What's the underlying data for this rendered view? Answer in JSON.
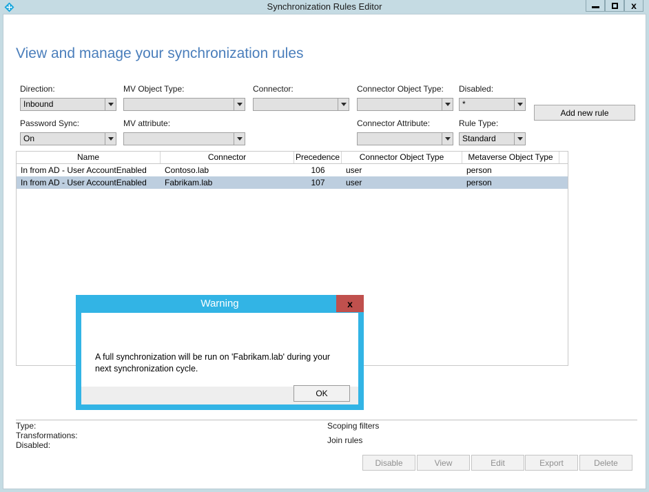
{
  "window": {
    "title": "Synchronization Rules Editor",
    "icon": "sync-diamond-icon",
    "minimize_label": "Minimize",
    "maximize_label": "Maximize",
    "close_label": "x"
  },
  "page": {
    "heading": "View and manage your synchronization rules",
    "heading_color": "#4a7ebb"
  },
  "filters": {
    "direction": {
      "label": "Direction:",
      "value": "Inbound"
    },
    "mv_object_type": {
      "label": "MV Object Type:",
      "value": ""
    },
    "connector": {
      "label": "Connector:",
      "value": ""
    },
    "connector_object_type": {
      "label": "Connector Object Type:",
      "value": ""
    },
    "disabled": {
      "label": "Disabled:",
      "value": "*"
    },
    "password_sync": {
      "label": "Password Sync:",
      "value": "On"
    },
    "mv_attribute": {
      "label": "MV attribute:",
      "value": ""
    },
    "connector_attribute": {
      "label": "Connector Attribute:",
      "value": ""
    },
    "rule_type": {
      "label": "Rule Type:",
      "value": "Standard"
    }
  },
  "toolbar": {
    "add_new_rule": "Add new rule"
  },
  "grid": {
    "columns": [
      "Name",
      "Connector",
      "Precedence",
      "Connector Object Type",
      "Metaverse Object Type"
    ],
    "rows": [
      {
        "name": "In from AD - User AccountEnabled",
        "connector": "Contoso.lab",
        "precedence": "106",
        "connector_object_type": "user",
        "metaverse_object_type": "person",
        "selected": false
      },
      {
        "name": "In from AD - User AccountEnabled",
        "connector": "Fabrikam.lab",
        "precedence": "107",
        "connector_object_type": "user",
        "metaverse_object_type": "person",
        "selected": true
      }
    ]
  },
  "details": {
    "type_label": "Type:",
    "transformations_label": "Transformations:",
    "disabled_label": "Disabled:",
    "scoping_filters_label": "Scoping filters",
    "join_rules_label": "Join rules"
  },
  "actions": {
    "disable": "Disable",
    "view": "View",
    "edit": "Edit",
    "export": "Export",
    "delete": "Delete"
  },
  "dialog": {
    "title": "Warning",
    "close_label": "x",
    "message": "A full synchronization will be run on 'Fabrikam.lab' during your next synchronization cycle.",
    "ok_label": "OK",
    "accent_color": "#32b4e5",
    "close_color": "#c0504d"
  }
}
